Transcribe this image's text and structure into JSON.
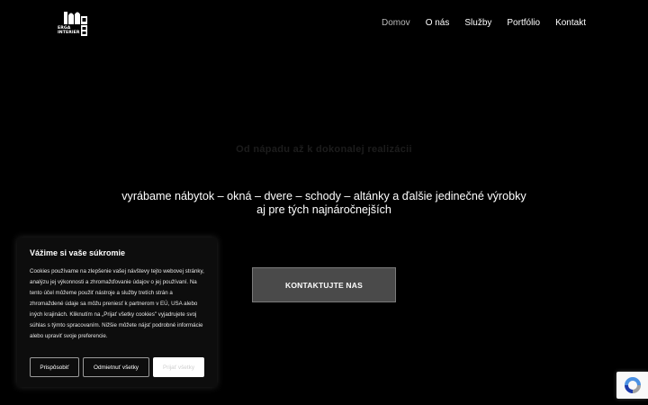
{
  "header": {
    "logo_text_line1": "ERGA",
    "logo_text_line2": "INTERIER",
    "nav": [
      {
        "label": "Domov",
        "active": true
      },
      {
        "label": "O nás"
      },
      {
        "label": "Služby"
      },
      {
        "label": "Portfólio"
      },
      {
        "label": "Kontakt"
      }
    ]
  },
  "hero": {
    "tagline": "Od nápadu až k dokonalej realizácii",
    "text_line1": "vyrábame nábytok – okná – dvere – schody – altánky a ďalšie jedinečné výrobky",
    "text_line2": "aj pre tých najnáročnejších",
    "cta_label": "KONTAKTUJTE NAS"
  },
  "cookie_banner": {
    "title": "Vážime si vaše súkromie",
    "body": "Cookies používame na zlepšenie vašej návštevy tejto webovej stránky, analýzu jej výkonnosti a zhromažďovanie údajov o jej používaní. Na tento účel môžeme použiť nástroje a služby tretích strán a zhromaždené údaje sa môžu preniesť k partnerom v EÚ, USA alebo iných krajinách. Kliknutím na „Prijať všetky cookies\" vyjadrujete svoj súhlas s týmto spracovaním. Nižšie môžete nájsť podrobné informácie alebo upraviť svoje preferencie.",
    "customize_label": "Prispôsobiť",
    "reject_label": "Odmietnuť všetky",
    "accept_label": "Prijať všetky"
  },
  "colors": {
    "background": "#000000",
    "nav_active": "#b9b9b9",
    "cta_background": "#4a4a4a",
    "cookie_background": "#0d0d0d"
  },
  "icons": {
    "logo": "erga-interier-logo-icon",
    "recaptcha": "recaptcha-icon"
  }
}
